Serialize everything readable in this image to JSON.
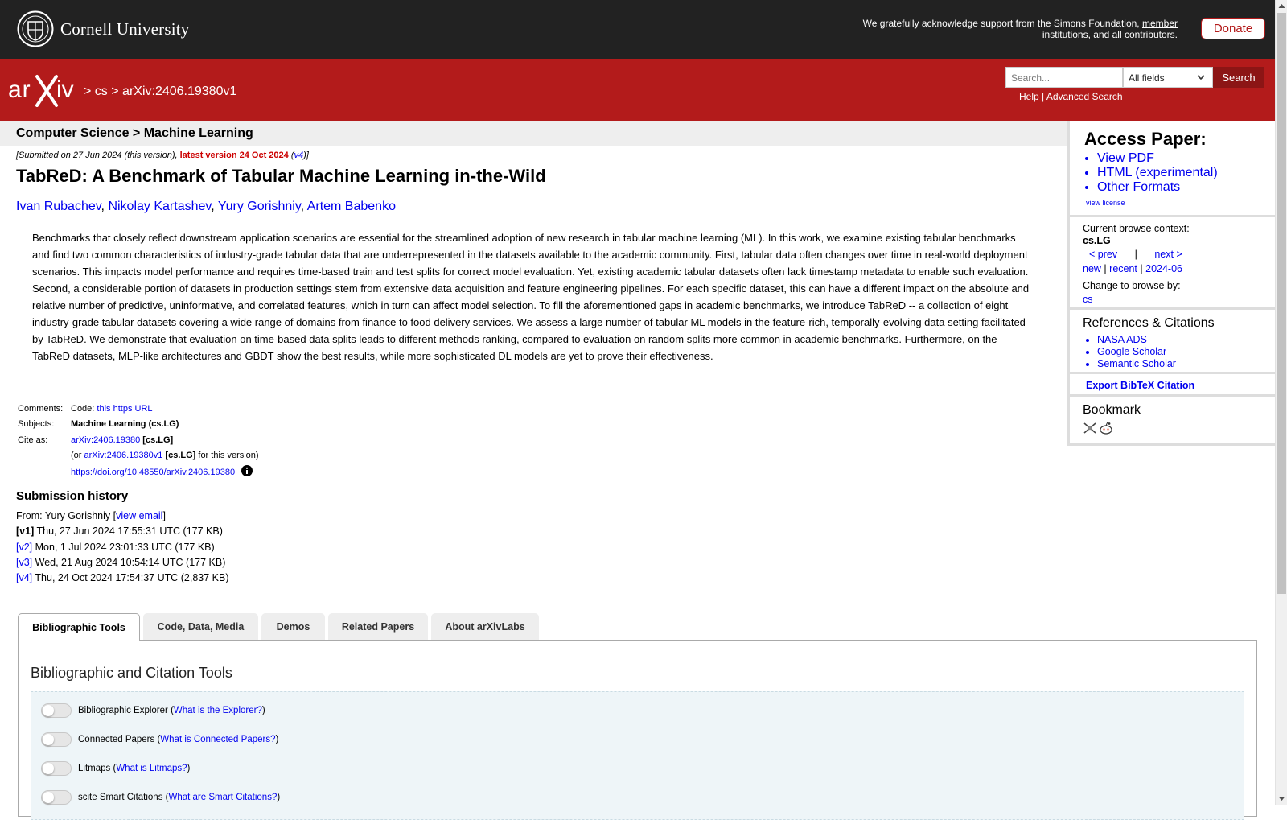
{
  "topbar": {
    "university": "Cornell University",
    "support_text": "We gratefully acknowledge support from the Simons Foundation,",
    "support_link": "member institutions",
    "support_tail": ", and all contributors.",
    "donate": "Donate"
  },
  "header": {
    "crumb_sep": ">",
    "crumb_cs": "cs",
    "crumb_id": "arXiv:2406.19380v1",
    "search_placeholder": "Search...",
    "search_field": "All fields",
    "search_button": "Search",
    "help": "Help",
    "help_sep": "|",
    "advanced": "Advanced Search"
  },
  "subject_bar": "Computer Science > Machine Learning",
  "dateline": {
    "pre": "[Submitted on 27 Jun 2024 (this version), ",
    "latest": "latest version 24 Oct 2024",
    "link": "v4",
    "post": ")]"
  },
  "paper": {
    "title": "TabReD: A Benchmark of Tabular Machine Learning in-the-Wild",
    "authors": [
      "Ivan Rubachev",
      "Nikolay Kartashev",
      "Yury Gorishniy",
      "Artem Babenko"
    ],
    "abstract": "Benchmarks that closely reflect downstream application scenarios are essential for the streamlined adoption of new research in tabular machine learning (ML). In this work, we examine existing tabular benchmarks and find two common characteristics of industry-grade tabular data that are underrepresented in the datasets available to the academic community. First, tabular data often changes over time in real-world deployment scenarios. This impacts model performance and requires time-based train and test splits for correct model evaluation. Yet, existing academic tabular datasets often lack timestamp metadata to enable such evaluation. Second, a considerable portion of datasets in production settings stem from extensive data acquisition and feature engineering pipelines. For each specific dataset, this can have a different impact on the absolute and relative number of predictive, uninformative, and correlated features, which in turn can affect model selection. To fill the aforementioned gaps in academic benchmarks, we introduce TabReD -- a collection of eight industry-grade tabular datasets covering a wide range of domains from finance to food delivery services. We assess a large number of tabular ML models in the feature-rich, temporally-evolving data setting facilitated by TabReD. We demonstrate that evaluation on time-based data splits leads to different methods ranking, compared to evaluation on random splits more common in academic benchmarks. Furthermore, on the TabReD datasets, MLP-like architectures and GBDT show the best results, while more sophisticated DL models are yet to prove their effectiveness."
  },
  "meta": {
    "comments_label": "Comments:",
    "comments_pre": "Code: ",
    "comments_link": "this https URL",
    "subjects_label": "Subjects:",
    "subjects": "Machine Learning (cs.LG)",
    "cite_label": "Cite as:",
    "cite_id": "arXiv:2406.19380",
    "cite_cat": "[cs.LG]",
    "cite_or_pre": "(or ",
    "cite_v1": "arXiv:2406.19380v1",
    "cite_v1_cat": "[cs.LG]",
    "cite_or_post": " for this version)",
    "doi": "https://doi.org/10.48550/arXiv.2406.19380"
  },
  "history": {
    "heading": "Submission history",
    "from_pre": "From: Yury Gorishniy [",
    "from_link": "view email",
    "from_post": "]",
    "versions": [
      {
        "tag": "[v1]",
        "text": " Thu, 27 Jun 2024 17:55:31 UTC (177 KB)"
      },
      {
        "tag": "[v2]",
        "text": " Mon, 1 Jul 2024 23:01:33 UTC (177 KB)"
      },
      {
        "tag": "[v3]",
        "text": " Wed, 21 Aug 2024 10:54:14 UTC (177 KB)"
      },
      {
        "tag": "[v4]",
        "text": " Thu, 24 Oct 2024 17:54:37 UTC (2,837 KB)"
      }
    ]
  },
  "tabs": [
    "Bibliographic Tools",
    "Code, Data, Media",
    "Demos",
    "Related Papers",
    "About arXivLabs"
  ],
  "panel": {
    "heading": "Bibliographic and Citation Tools",
    "tools": [
      {
        "name": "Bibliographic Explorer",
        "link": "What is the Explorer?"
      },
      {
        "name": "Connected Papers",
        "link": "What is Connected Papers?"
      },
      {
        "name": "Litmaps",
        "link": "What is Litmaps?"
      },
      {
        "name": "scite Smart Citations",
        "link": "What are Smart Citations?"
      }
    ]
  },
  "sidebar": {
    "access_heading": "Access Paper:",
    "access_links": [
      "View PDF",
      "HTML (experimental)",
      "Other Formats"
    ],
    "license": "view license",
    "context_label": "Current browse context:",
    "context_value": "cs.LG",
    "prev": "< prev",
    "nav_sep": "|",
    "next": "next >",
    "new": "new",
    "recent": "recent",
    "month": "2024-06",
    "change_label": "Change to browse by:",
    "change_value": "cs",
    "refs_heading": "References & Citations",
    "refs_links": [
      "NASA ADS",
      "Google Scholar",
      "Semantic Scholar"
    ],
    "bibtex": "Export BibTeX Citation",
    "bookmark_heading": "Bookmark"
  },
  "colors": {
    "brand_red": "#b31b1b",
    "topbar": "#222222",
    "link": "#0000ee"
  }
}
